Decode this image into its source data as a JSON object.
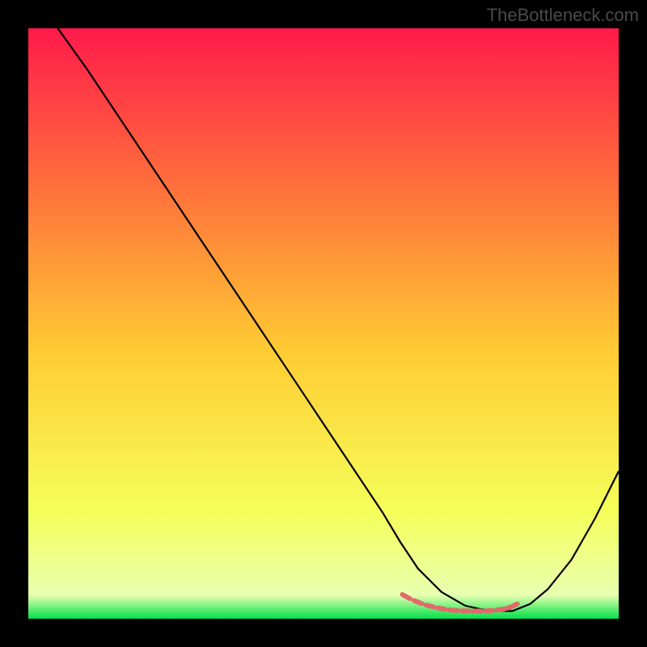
{
  "watermark": "TheBottleneck.com",
  "chart_data": {
    "type": "line",
    "title": "",
    "xlabel": "",
    "ylabel": "",
    "xlim": [
      0,
      100
    ],
    "ylim": [
      0,
      100
    ],
    "gradient_colors": {
      "top": "#ff1a4a",
      "upper_mid": "#ff7a3a",
      "mid": "#ffcc33",
      "lower_mid": "#f5ff5a",
      "bottom": "#00e24a"
    },
    "series": [
      {
        "name": "curve",
        "x": [
          5,
          10,
          15,
          20,
          25,
          30,
          35,
          40,
          45,
          50,
          55,
          60,
          63,
          66,
          70,
          74,
          78,
          82,
          85,
          88,
          92,
          96,
          100
        ],
        "y": [
          100,
          93,
          85.5,
          78,
          70.5,
          63,
          55.5,
          48,
          40.5,
          33,
          25.5,
          18,
          13,
          8.5,
          4.5,
          2.2,
          1.3,
          1.3,
          2.5,
          5,
          10,
          17,
          25
        ],
        "color": "#000000"
      },
      {
        "name": "highlight-dashes",
        "x": [
          63,
          65,
          67,
          69,
          71,
          73,
          75,
          77,
          79,
          81,
          82,
          83
        ],
        "y": [
          4.3,
          3.2,
          2.4,
          1.9,
          1.5,
          1.35,
          1.3,
          1.3,
          1.4,
          1.7,
          2.1,
          2.6
        ],
        "color": "#e06a6a"
      }
    ]
  }
}
